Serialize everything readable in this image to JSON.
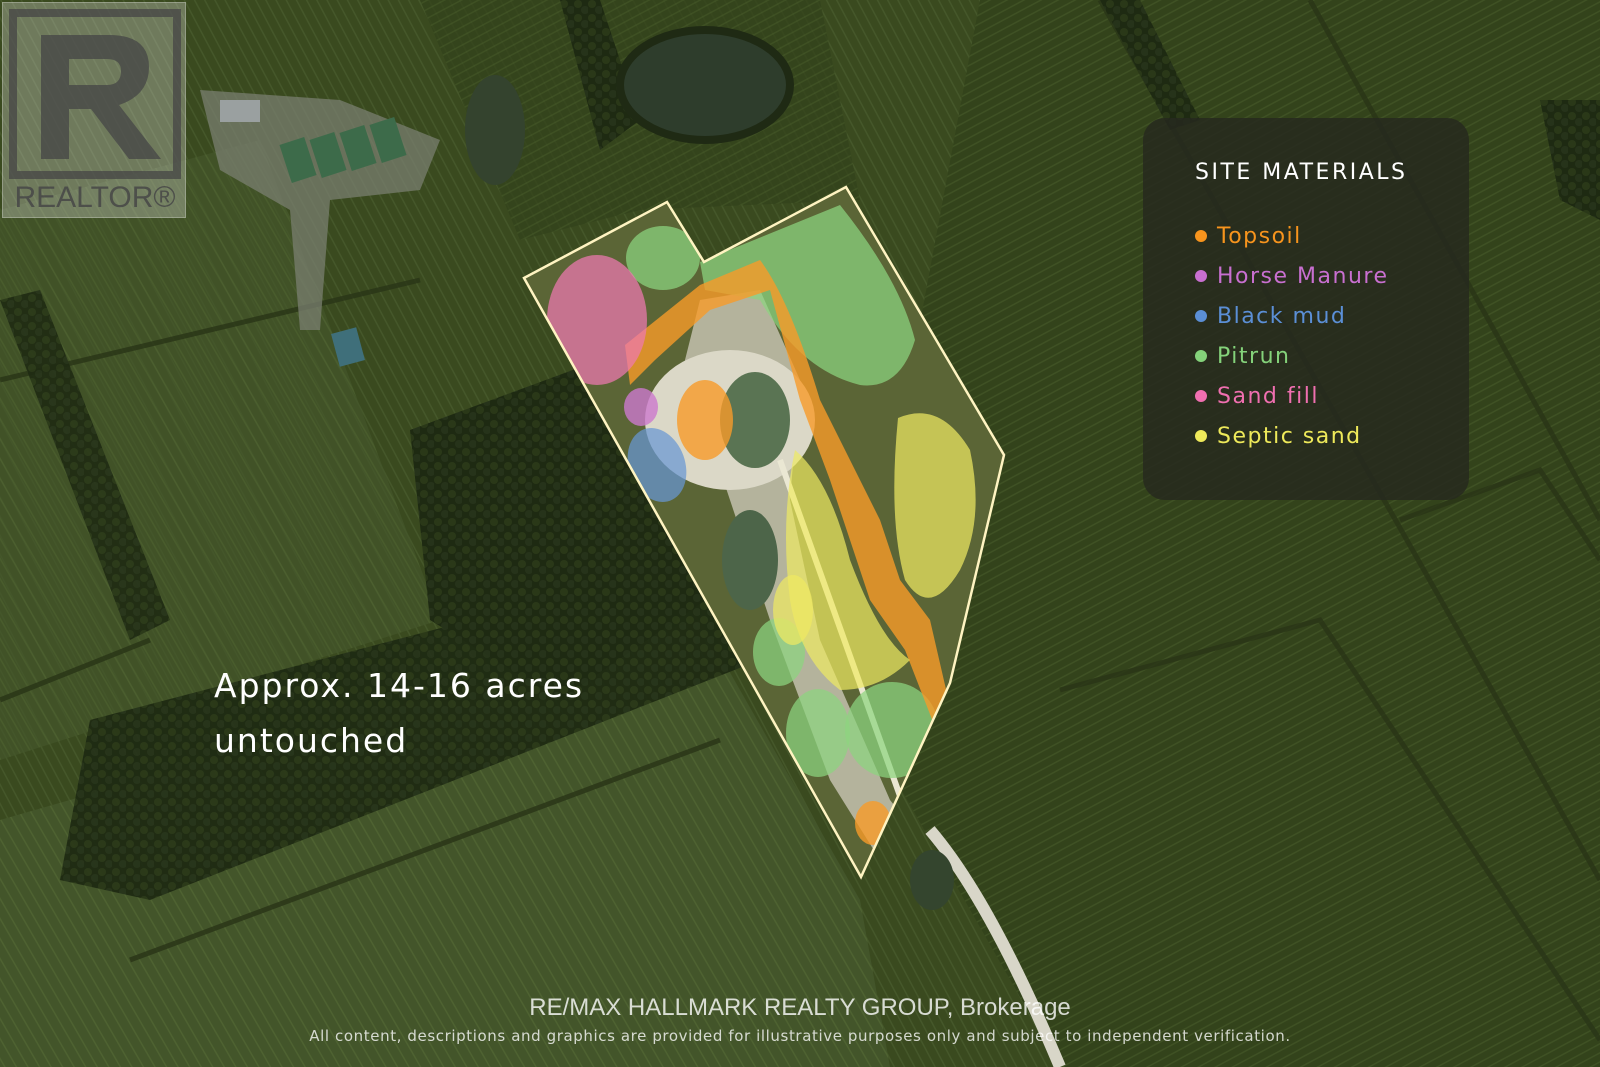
{
  "watermark": {
    "logo_mark": "R",
    "logo_text": "REALTOR®"
  },
  "legend": {
    "title": "SITE MATERIALS",
    "items": [
      {
        "label": "Topsoil",
        "color": "#f7941d",
        "icon": "dot"
      },
      {
        "label": "Horse Manure",
        "color": "#c86fd0",
        "icon": "dot"
      },
      {
        "label": "Black mud",
        "color": "#5b8fd6",
        "icon": "dot"
      },
      {
        "label": "Pitrun",
        "color": "#84d27a",
        "icon": "dot"
      },
      {
        "label": "Sand fill",
        "color": "#f06fb0",
        "icon": "dot"
      },
      {
        "label": "Septic sand",
        "color": "#eee95a",
        "icon": "dot"
      }
    ]
  },
  "annotation": {
    "line1": "Approx. 14-16 acres",
    "line2": "untouched"
  },
  "footer": {
    "brokerage": "RE/MAX HALLMARK REALTY GROUP, Brokerage",
    "disclaimer": "All content, descriptions and graphics are provided for illustrative purposes only and subject to independent verification."
  },
  "colors": {
    "field_dark": "#2f3d1a",
    "field_light": "#4a5a25",
    "forest": "#1f2a14",
    "parcel_outline": "#fff4c2"
  }
}
